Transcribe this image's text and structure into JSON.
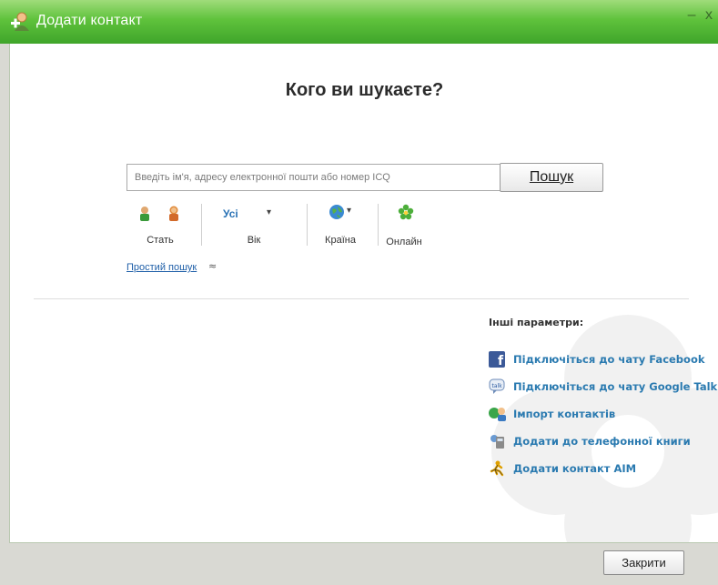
{
  "window": {
    "title": "Додати контакт",
    "minimize_glyph": "–",
    "close_glyph": "x",
    "close_button_label": "Закрити"
  },
  "search": {
    "heading": "Кого ви шукаєте?",
    "placeholder": "Введіть ім'я, адресу електронної пошти або номер ICQ",
    "value": "",
    "button_label": "Пошук"
  },
  "filters": {
    "gender_label": "Стать",
    "age_value": "Усі",
    "age_label": "Вік",
    "country_label": "Країна",
    "online_label": "Онлайн",
    "caret": "▾"
  },
  "simple_search": {
    "label": "Простий пошук",
    "collapse_glyph": "≈"
  },
  "other": {
    "title": "Інші параметри:",
    "links": [
      {
        "icon": "facebook-icon",
        "label": "Підключіться до чату Facebook"
      },
      {
        "icon": "google-talk-icon",
        "label": "Підключіться до чату Google Talk"
      },
      {
        "icon": "import-contacts-icon",
        "label": "Імпорт контактів"
      },
      {
        "icon": "phonebook-icon",
        "label": "Додати до телефонної книги"
      },
      {
        "icon": "aim-icon",
        "label": "Додати контакт AIM"
      }
    ]
  },
  "colors": {
    "title_bar_green": "#5fc23c",
    "link_blue": "#2a7ab0",
    "simple_search_link": "#1f5fa8"
  }
}
